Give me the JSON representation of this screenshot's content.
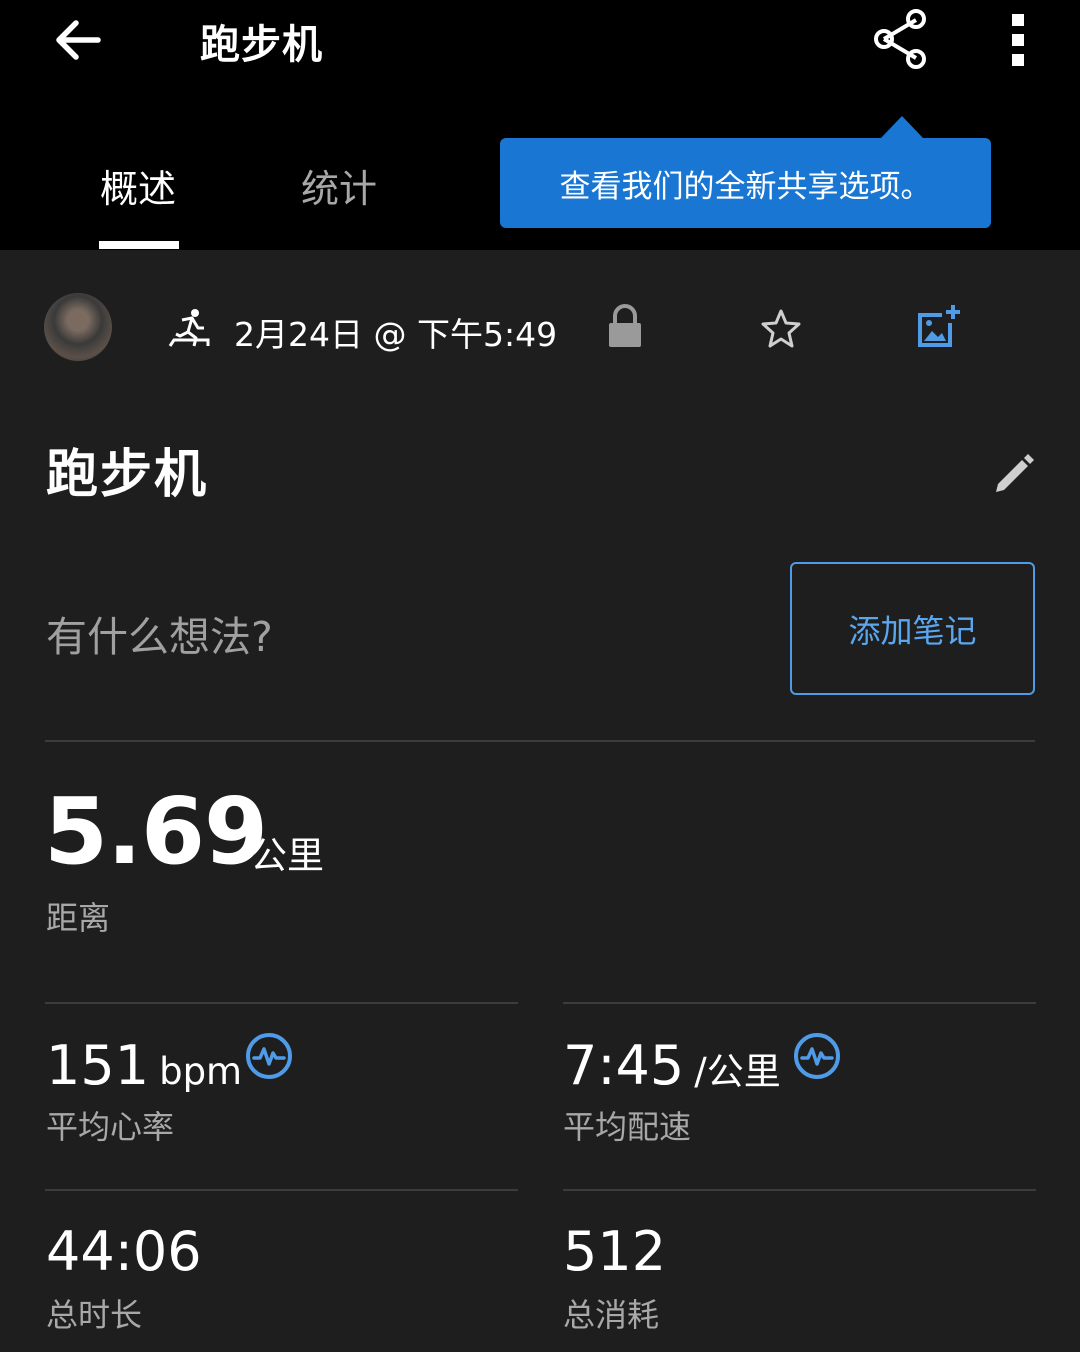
{
  "header": {
    "title": "跑步机",
    "back_icon": "arrow-left-icon",
    "share_icon": "share-icon",
    "more_icon": "more-vertical-icon"
  },
  "tabs": [
    {
      "label": "概述",
      "selected": true
    },
    {
      "label": "统计",
      "selected": false
    }
  ],
  "tooltip": {
    "text": "查看我们的全新共享选项。",
    "color": "#1976d2"
  },
  "activity": {
    "date_time": "2月24日 @ 下午5:49",
    "type_icon": "treadmill-running-icon",
    "privacy_icon": "lock-icon",
    "favorite_icon": "star-outline-icon",
    "add_photo_icon": "add-photo-icon",
    "name": "跑步机",
    "edit_icon": "pencil-icon"
  },
  "notes": {
    "placeholder": "有什么想法?",
    "button_label": "添加笔记"
  },
  "stats": {
    "distance": {
      "value": "5.69",
      "unit": "公里",
      "label": "距离"
    },
    "avg_heart_rate": {
      "value": "151",
      "unit": "bpm",
      "label": "平均心率",
      "badge_icon": "heart-pulse-badge-icon"
    },
    "avg_pace": {
      "value": "7:45",
      "unit": "/公里",
      "label": "平均配速",
      "badge_icon": "heart-pulse-badge-icon"
    },
    "total_time": {
      "value": "44:06",
      "label": "总时长"
    },
    "calories": {
      "value": "512",
      "label": "总消耗"
    }
  },
  "colors": {
    "accent": "#4f9be8",
    "background": "#1e1e1e",
    "header": "#000000"
  }
}
